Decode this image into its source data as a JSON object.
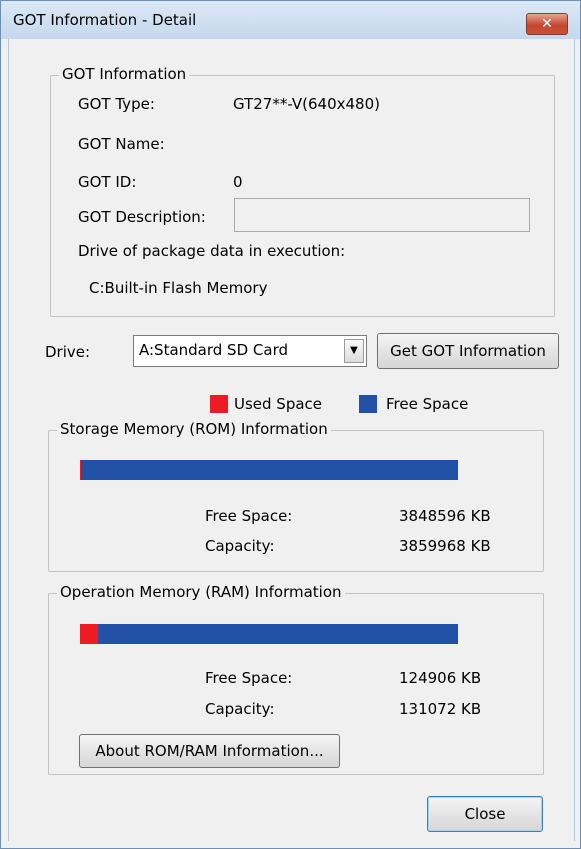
{
  "window": {
    "title": "GOT Information - Detail",
    "close_symbol": "✕"
  },
  "got_info": {
    "group_label": "GOT Information",
    "type_label": "GOT Type:",
    "type_value": "GT27**-V(640x480)",
    "name_label": "GOT Name:",
    "name_value": "",
    "id_label": "GOT ID:",
    "id_value": "0",
    "description_label": "GOT Description:",
    "description_value": "",
    "drive_exec_label": "Drive of package data in execution:",
    "drive_exec_value": "C:Built-in Flash Memory"
  },
  "drive": {
    "label": "Drive:",
    "selected": "A:Standard SD Card",
    "get_info_button": "Get GOT Information",
    "get_info_underline_char": "I"
  },
  "legend": {
    "used_label": "Used Space",
    "free_label": "Free Space",
    "used_color": "#ed1c24",
    "free_color": "#2152a8"
  },
  "rom": {
    "group_label": "Storage Memory (ROM) Information",
    "used_fraction": 0.003,
    "free_label": "Free Space:",
    "free_value": "3848596 KB",
    "capacity_label": "Capacity:",
    "capacity_value": "3859968 KB"
  },
  "ram": {
    "group_label": "Operation Memory (RAM) Information",
    "used_fraction": 0.047,
    "free_label": "Free Space:",
    "free_value": "124906 KB",
    "capacity_label": "Capacity:",
    "capacity_value": "131072 KB"
  },
  "buttons": {
    "about": "About ROM/RAM Information...",
    "close": "Close"
  }
}
